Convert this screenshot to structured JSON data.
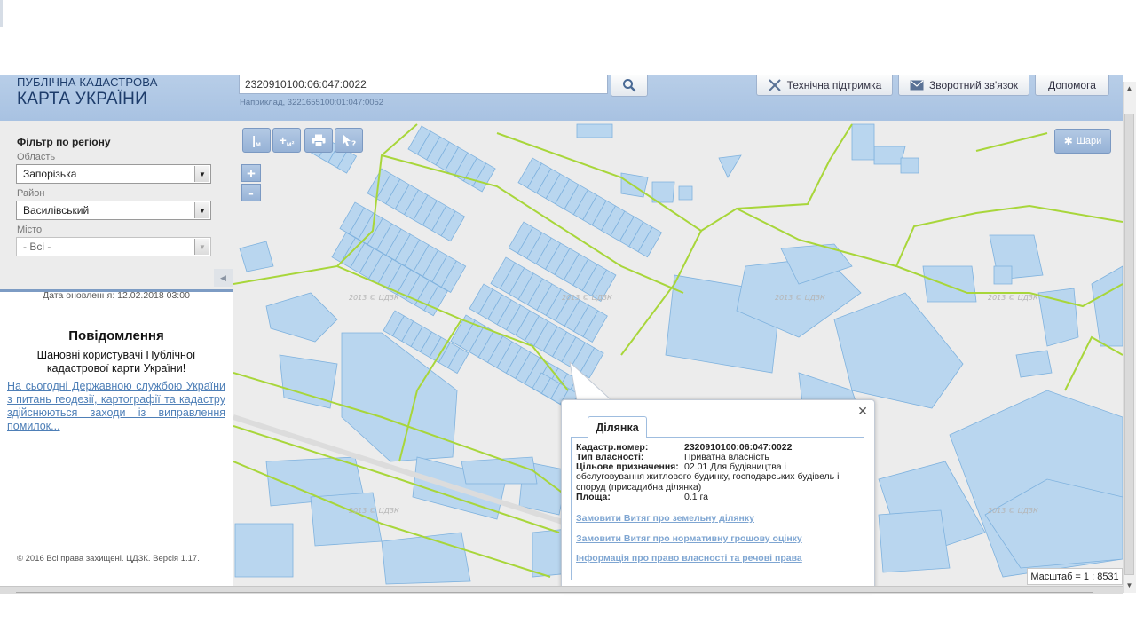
{
  "header": {
    "logo_top": "ПУБЛІЧНА КАДАСТРОВА",
    "logo_main": "КАРТА УКРАЇНИ",
    "search_value": "2320910100:06:047:0022",
    "search_hint": "Наприклад, 3221655100:01:047:0052",
    "support_label": "Технічна підтримка",
    "feedback_label": "Зворотний зв'язок",
    "help_label": "Допомога"
  },
  "filter": {
    "title": "Фільтр по регіону",
    "oblast_label": "Область",
    "oblast_value": "Запорізька",
    "raion_label": "Район",
    "raion_value": "Василівський",
    "misto_label": "Місто",
    "misto_value": "- Всі -"
  },
  "sidebar": {
    "update_date": "Дата оновлення: 12.02.2018 03:00",
    "news_title": "Повідомлення",
    "news_greeting": "Шановні користувачі Публічної кадастрової карти України!",
    "news_link": "На сьогодні Державною службою України з питань геодезії, картографії та кадастру здійснюються заходи із виправлення помилок...",
    "copyright": "© 2016 Всі права захищені. ЦДЗК. Версія 1.17."
  },
  "map": {
    "tools": [
      "м",
      "м²",
      "print",
      "info"
    ],
    "layers_label": "Шари",
    "scale_text": "Масштаб = 1 : 8531",
    "watermark": "2013 © ЦДЗК",
    "colors": {
      "parcel_fill": "#b9d6ef",
      "parcel_stroke": "#7fb2de",
      "boundary": "#a8d63a",
      "background": "#ececec"
    }
  },
  "popup": {
    "tab_label": "Ділянка",
    "cad_label": "Кадастр.номер:",
    "cad_value": "2320910100:06:047:0022",
    "owner_label": "Тип власності:",
    "owner_value": "Приватна власність",
    "purpose_label": "Цільове призначення:",
    "purpose_value_line1": "02.01 Для будівництва і",
    "purpose_value_rest": "обслуговування житлового будинку, господарських будівель і споруд (присадибна ділянка)",
    "area_label": "Площа:",
    "area_value": "0.1 га",
    "link1": "Замовити Витяг про земельну ділянку",
    "link2": "Замовити Витяг про нормативну грошову оцінку",
    "link3": "Інформація про право власності та речові права"
  }
}
